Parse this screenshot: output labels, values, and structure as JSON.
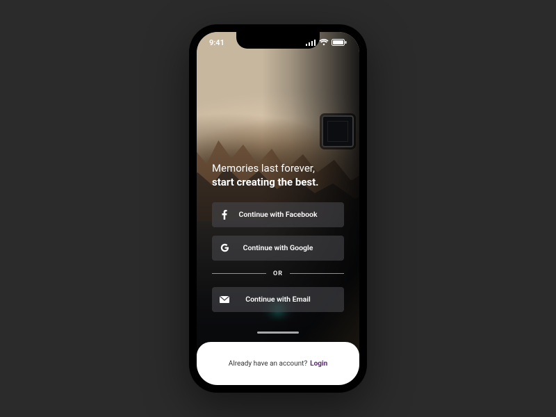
{
  "statusbar": {
    "time": "9:41"
  },
  "headline": {
    "line1": "Memories last forever,",
    "line2": "start creating the best."
  },
  "buttons": {
    "facebook": "Continue with Facebook",
    "google": "Continue  with Google",
    "email": "Continue with Email"
  },
  "divider": "OR",
  "footer": {
    "prompt": "Already have an account?",
    "action": "Login"
  },
  "colors": {
    "login_accent": "#5a2a73"
  }
}
